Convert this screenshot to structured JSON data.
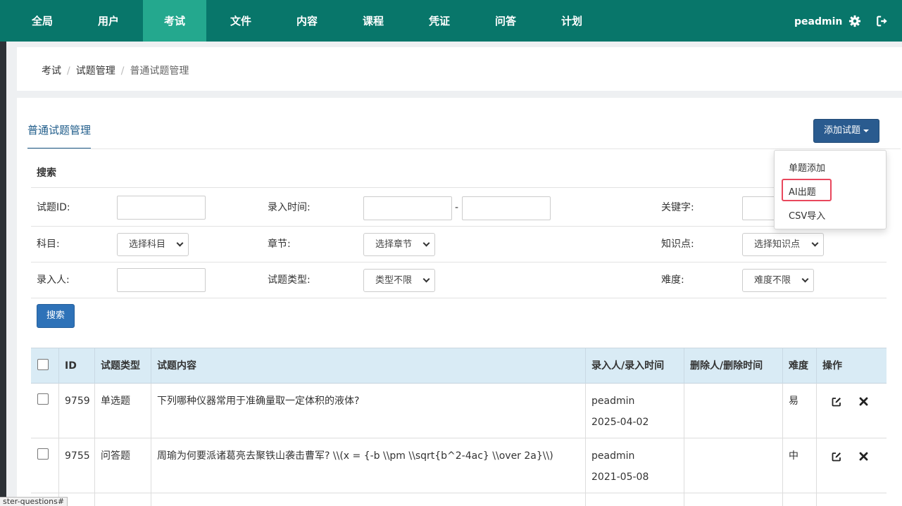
{
  "nav": {
    "items": [
      "全局",
      "用户",
      "考试",
      "文件",
      "内容",
      "课程",
      "凭证",
      "问答",
      "计划"
    ],
    "active": "考试",
    "username": "peadmin"
  },
  "breadcrumb": [
    "考试",
    "试题管理",
    "普通试题管理"
  ],
  "tab": "普通试题管理",
  "add_button": "添加试题",
  "dropdown": [
    "单题添加",
    "AI出题",
    "CSV导入"
  ],
  "search": {
    "title": "搜索",
    "labels": {
      "question_id": "试题ID:",
      "entry_time": "录入时间:",
      "keyword": "关键字:",
      "subject": "科目:",
      "chapter": "章节:",
      "knowledge": "知识点:",
      "entered_by": "录入人:",
      "question_type": "试题类型:",
      "difficulty": "难度:"
    },
    "selects": {
      "subject": "选择科目",
      "chapter": "选择章节",
      "knowledge": "选择知识点",
      "question_type": "类型不限",
      "difficulty": "难度不限"
    },
    "date_sep": "-",
    "button": "搜索"
  },
  "table": {
    "headers": [
      "ID",
      "试题类型",
      "试题内容",
      "录入人/录入时间",
      "删除人/删除时间",
      "难度",
      "操作"
    ],
    "rows": [
      {
        "id": "9759",
        "type": "单选题",
        "content": "下列哪种仪器常用于准确量取一定体积的液体?",
        "user": "peadmin",
        "date": "2025-04-02",
        "deleted": "",
        "difficulty": "易"
      },
      {
        "id": "9755",
        "type": "问答题",
        "content": "周瑜为何要派诸葛亮去聚铁山袭击曹军? \\\\(x = {-b \\\\pm \\\\sqrt{b^2-4ac} \\\\over 2a}\\\\)",
        "user": "peadmin",
        "date": "2021-05-08",
        "deleted": "",
        "difficulty": "中"
      }
    ]
  },
  "status_tip": "ster-questions#"
}
